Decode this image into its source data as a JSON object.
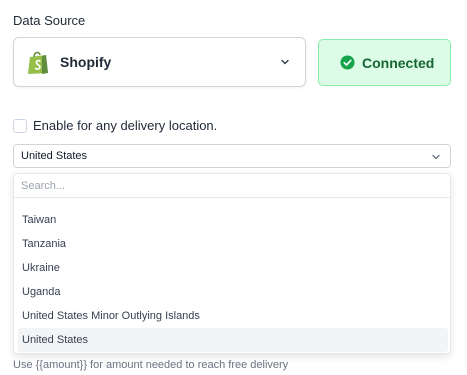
{
  "data_source": {
    "label": "Data Source",
    "selected": "Shopify",
    "icon": "shopify-bag-icon",
    "brand_color": "#95bf47"
  },
  "status": {
    "text": "Connected",
    "icon": "check-circle-icon",
    "color": "#16a34a"
  },
  "delivery": {
    "checkbox_label": "Enable for any delivery location.",
    "checked": false
  },
  "country_select": {
    "value": "United States",
    "search_placeholder": "Search...",
    "options": [
      "Taiwan",
      "Tanzania",
      "Ukraine",
      "Uganda",
      "United States Minor Outlying Islands",
      "United States"
    ],
    "selected_index": 5
  },
  "helper_text": "Use {{amount}} for amount needed to reach free delivery"
}
